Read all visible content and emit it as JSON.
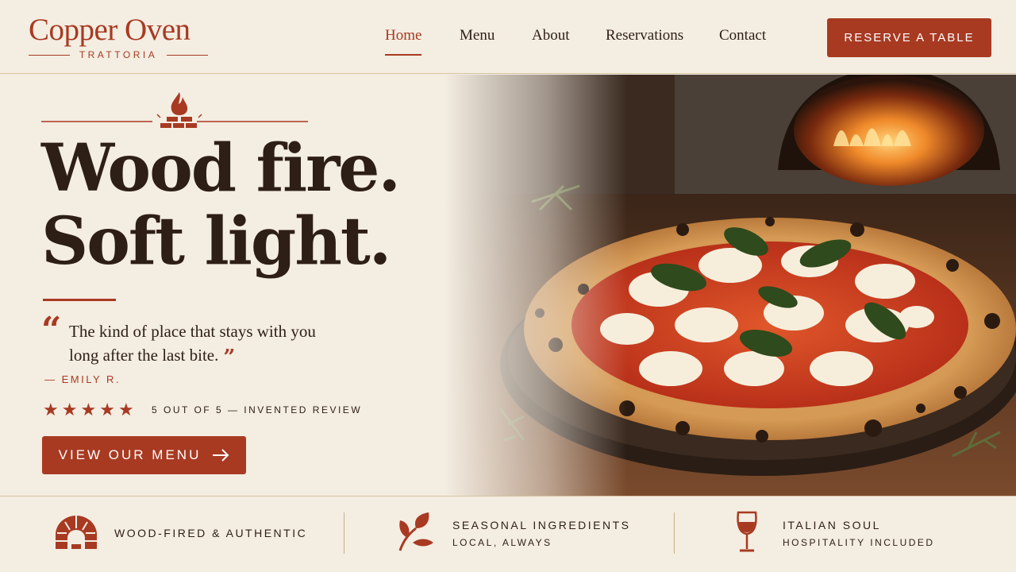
{
  "brand": {
    "name": "Copper Oven",
    "subtitle": "TRATTORIA"
  },
  "nav": {
    "items": [
      {
        "label": "Home",
        "active": true
      },
      {
        "label": "Menu",
        "active": false
      },
      {
        "label": "About",
        "active": false
      },
      {
        "label": "Reservations",
        "active": false
      },
      {
        "label": "Contact",
        "active": false
      }
    ],
    "cta_label": "RESERVE A TABLE"
  },
  "hero": {
    "headline_line1": "Wood fire.",
    "headline_line2": "Soft light.",
    "quote": "The kind of place that stays with you long after the last bite.",
    "reviewer": "— EMILY R.",
    "rating": 5,
    "rating_text": "5 OUT OF 5 — INVENTED REVIEW",
    "cta_label": "VIEW OUR MENU"
  },
  "features": [
    {
      "title": "WOOD-FIRED & AUTHENTIC",
      "subtitle": "",
      "icon": "wood-oven-icon"
    },
    {
      "title": "SEASONAL INGREDIENTS",
      "subtitle": "LOCAL, ALWAYS",
      "icon": "leaf-icon"
    },
    {
      "title": "ITALIAN SOUL",
      "subtitle": "HOSPITALITY INCLUDED",
      "icon": "wine-glass-icon"
    }
  ],
  "colors": {
    "accent": "#a83a22",
    "background": "#f4ede2",
    "text": "#2e1f16"
  }
}
